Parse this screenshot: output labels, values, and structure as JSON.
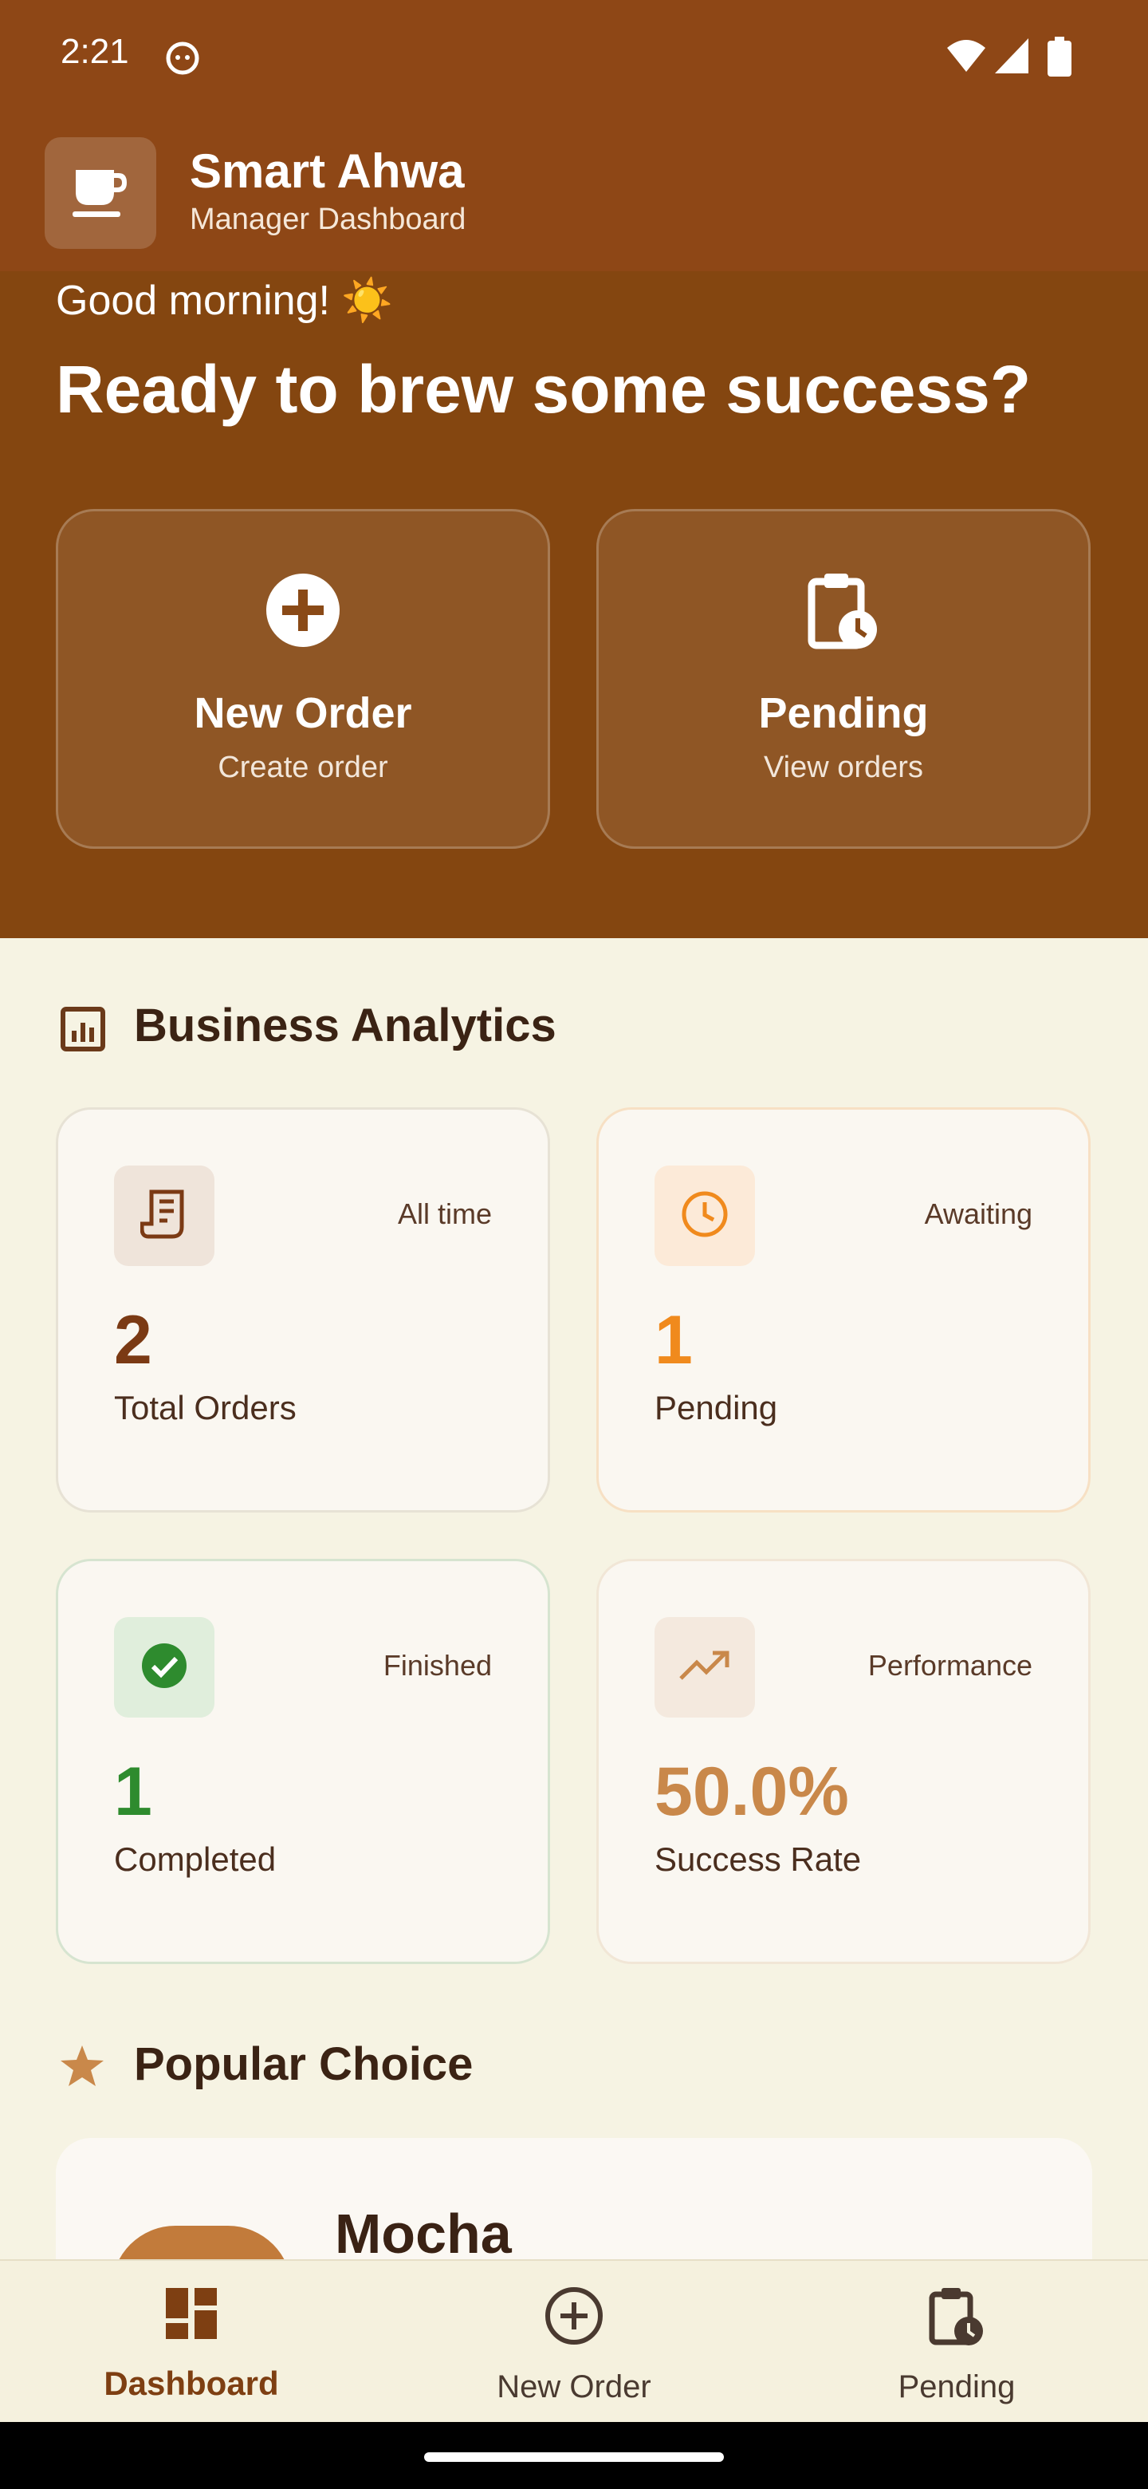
{
  "status_bar": {
    "time": "2:21"
  },
  "app": {
    "title": "Smart Ahwa",
    "subtitle": "Manager Dashboard",
    "icon": "coffee-cup-icon"
  },
  "hero": {
    "greeting": "Good morning! ☀️",
    "headline": "Ready to brew some success?"
  },
  "actions": [
    {
      "title": "New Order",
      "subtitle": "Create order",
      "icon": "add-circle-icon"
    },
    {
      "title": "Pending",
      "subtitle": "View orders",
      "icon": "clipboard-clock-icon"
    }
  ],
  "analytics": {
    "title": "Business Analytics",
    "cards": [
      {
        "tag": "All time",
        "value": "2",
        "label": "Total Orders",
        "icon": "receipt-icon",
        "color": "#7B3A14"
      },
      {
        "tag": "Awaiting",
        "value": "1",
        "label": "Pending",
        "icon": "clock-icon",
        "color": "#F08A1D"
      },
      {
        "tag": "Finished",
        "value": "1",
        "label": "Completed",
        "icon": "check-circle-icon",
        "color": "#2E8B2E"
      },
      {
        "tag": "Performance",
        "value": "50.0%",
        "label": "Success Rate",
        "icon": "trending-up-icon",
        "color": "#C9884A"
      }
    ]
  },
  "popular": {
    "title": "Popular Choice",
    "item_name": "Mocha"
  },
  "bottom_nav": [
    {
      "label": "Dashboard",
      "icon": "dashboard-icon",
      "active": true
    },
    {
      "label": "New Order",
      "icon": "add-circle-outline-icon",
      "active": false
    },
    {
      "label": "Pending",
      "icon": "clipboard-clock-icon",
      "active": false
    }
  ],
  "colors": {
    "hero_bg": "#844610",
    "brown_dark": "#3B2314",
    "accent_orange": "#F08A1D",
    "success_green": "#2E8B2E",
    "page_bg": "#F6F3E3"
  }
}
